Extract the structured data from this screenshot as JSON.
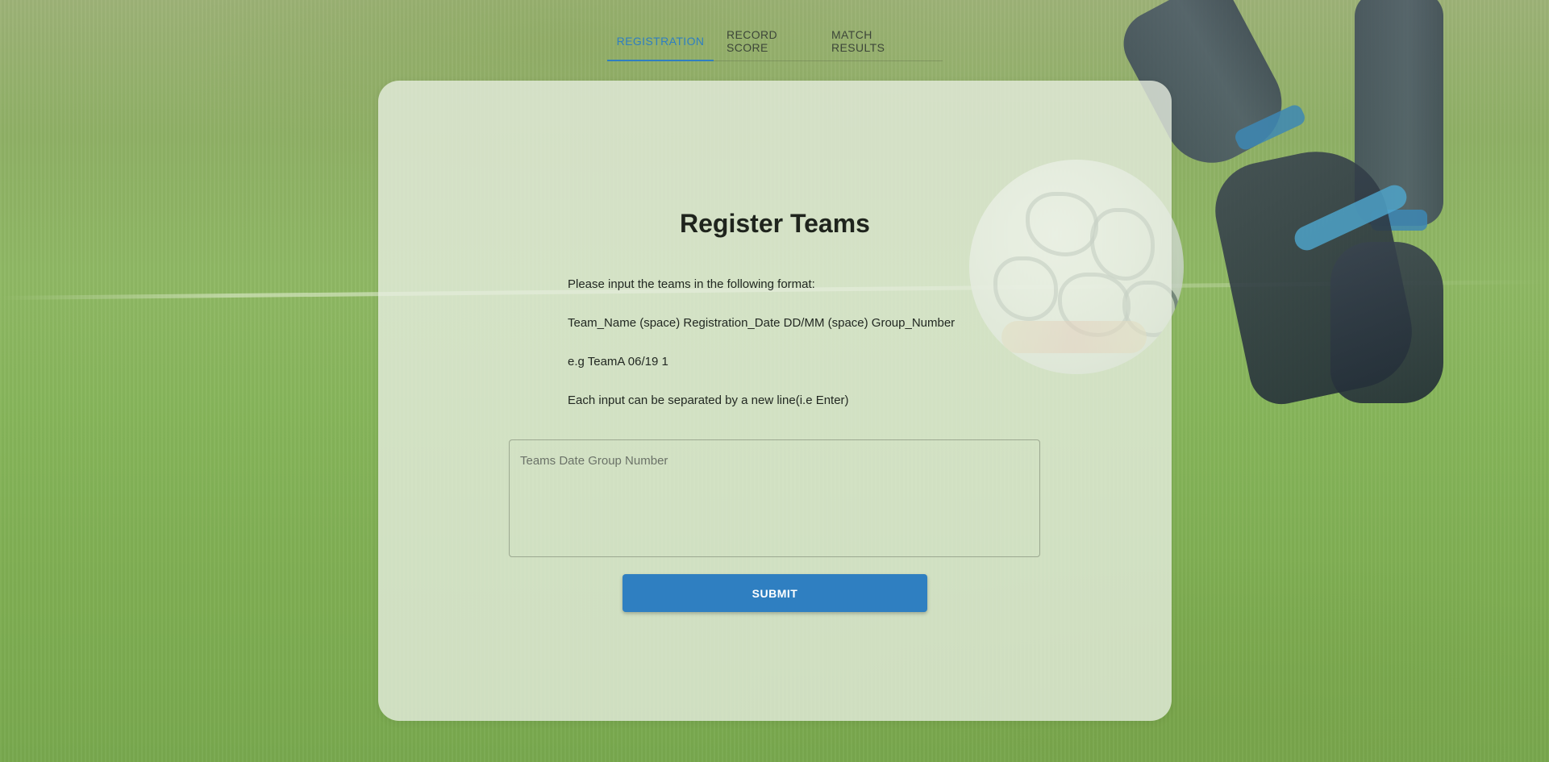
{
  "tabs": [
    {
      "label": "REGISTRATION",
      "active": true
    },
    {
      "label": "RECORD SCORE",
      "active": false
    },
    {
      "label": "MATCH RESULTS",
      "active": false
    }
  ],
  "card": {
    "title": "Register Teams",
    "instructions": [
      "Please input the teams in the following format:",
      "Team_Name (space) Registration_Date DD/MM (space) Group_Number",
      "e.g TeamA 06/19 1",
      "Each input can be separated by a new line(i.e Enter)"
    ],
    "input": {
      "value": "",
      "placeholder": "Teams Date Group Number"
    },
    "submit_label": "SUBMIT"
  },
  "colors": {
    "accent": "#2f7fc1",
    "card_background": "#e8eee2",
    "text": "#222822"
  },
  "background": {
    "icons": [
      "soccer-field",
      "soccer-ball",
      "player-boots"
    ]
  }
}
